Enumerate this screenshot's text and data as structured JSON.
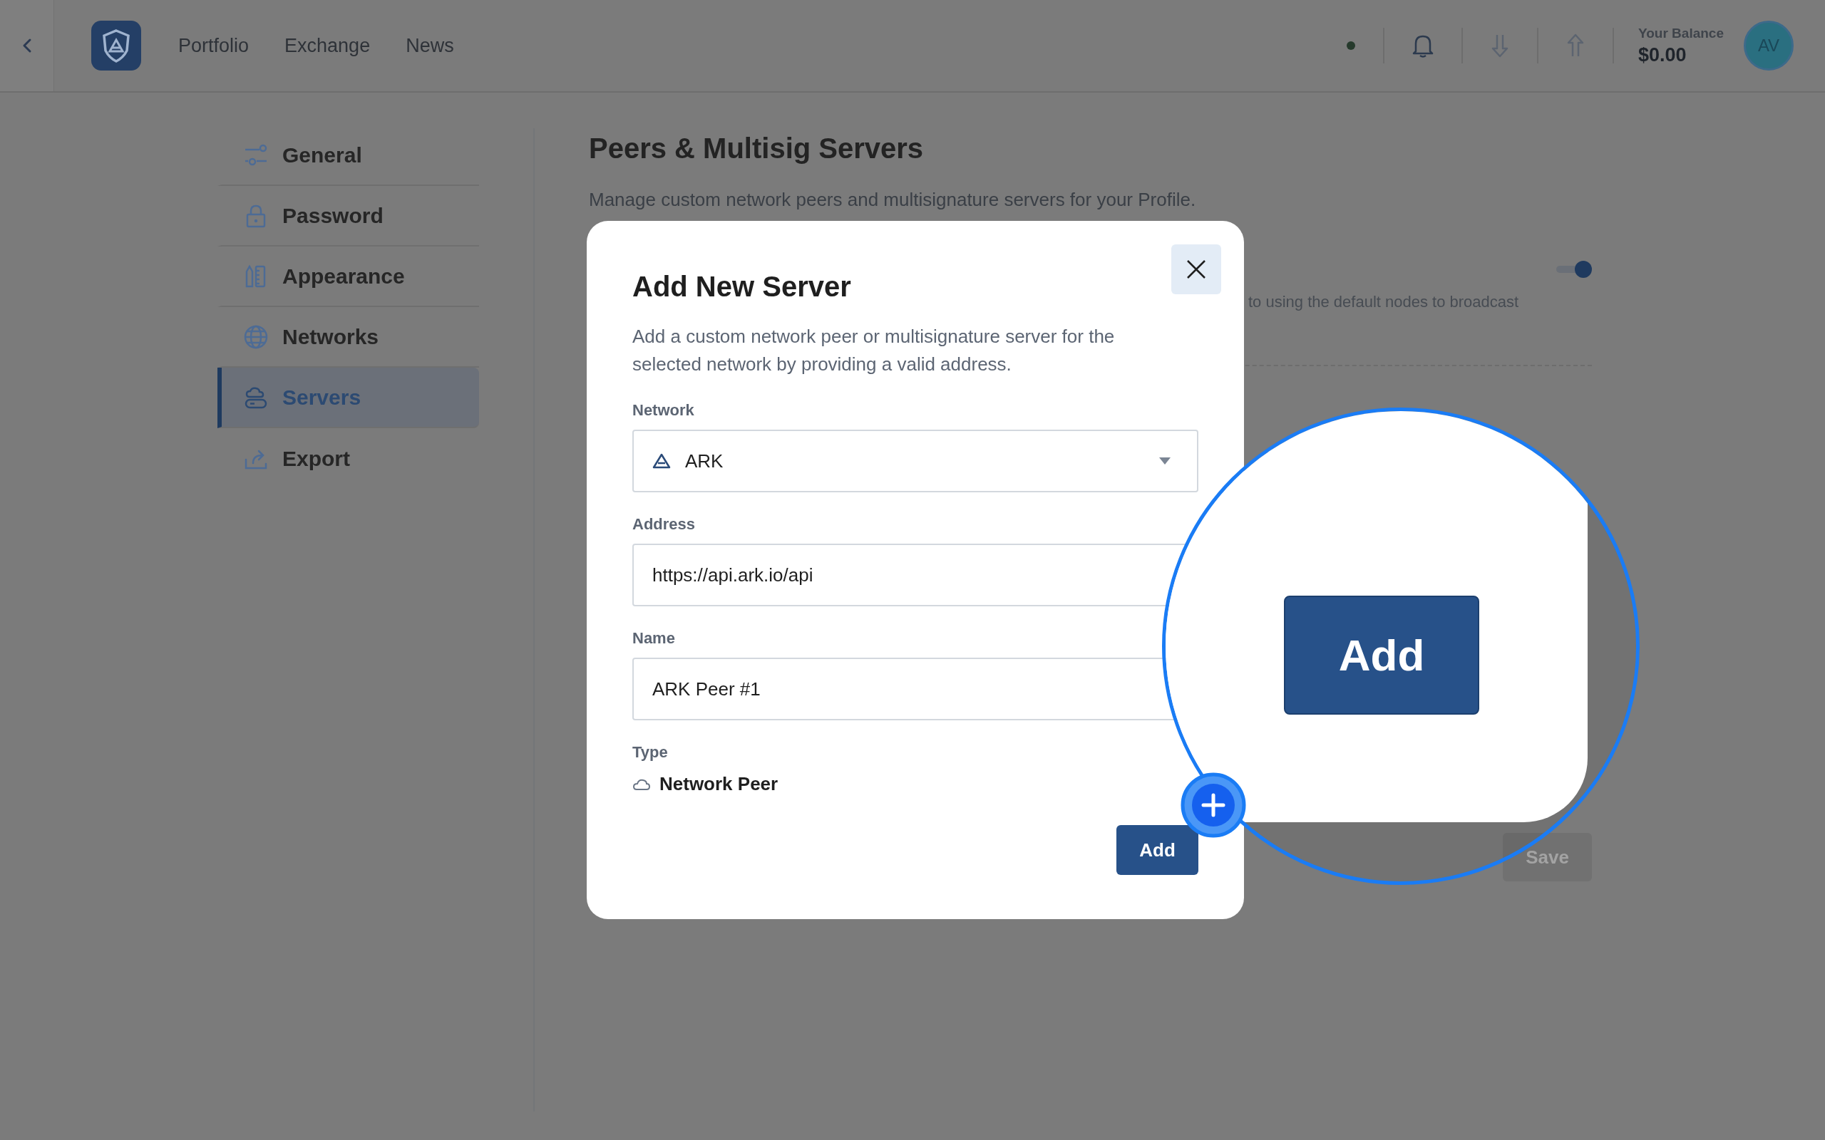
{
  "header": {
    "nav": [
      {
        "label": "Portfolio"
      },
      {
        "label": "Exchange"
      },
      {
        "label": "News"
      }
    ],
    "balance_label": "Your Balance",
    "balance": "$0.00",
    "avatar": "AV"
  },
  "sidebar": {
    "items": [
      {
        "label": "General",
        "kind": "sliders",
        "selected": false
      },
      {
        "label": "Password",
        "kind": "lock",
        "selected": false
      },
      {
        "label": "Appearance",
        "kind": "ruler",
        "selected": false
      },
      {
        "label": "Networks",
        "kind": "globe",
        "selected": false
      },
      {
        "label": "Servers",
        "kind": "servers",
        "selected": true
      },
      {
        "label": "Export",
        "kind": "export",
        "selected": false
      }
    ]
  },
  "page": {
    "title": "Peers & Multisig Servers",
    "description": "Manage custom network peers and multisignature servers for your Profile.",
    "partial_text": "to using the default nodes to broadcast",
    "toggle": {
      "on": true
    },
    "save_button": {
      "label": "Save",
      "disabled": true
    }
  },
  "modal": {
    "title": "Add New Server",
    "description": "Add a custom network peer or multisignature server for the selected network by providing a valid address.",
    "network": {
      "label": "Network",
      "value": "ARK"
    },
    "address": {
      "label": "Address",
      "value": "https://api.ark.io/api"
    },
    "name": {
      "label": "Name",
      "value": "ARK Peer #1"
    },
    "type": {
      "label": "Type",
      "value": "Network Peer"
    },
    "add_button": "Add"
  },
  "magnifier": {
    "button": "Add"
  }
}
